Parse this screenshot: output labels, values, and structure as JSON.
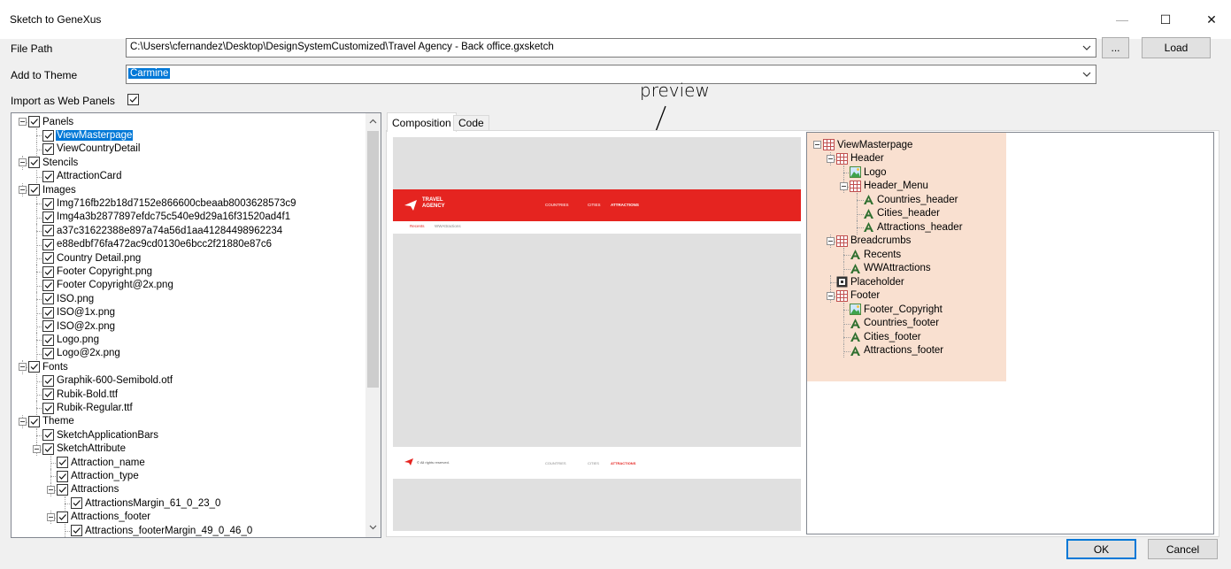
{
  "window": {
    "title": "Sketch to GeneXus",
    "minimize_glyph": "—",
    "maximize_glyph": "☐",
    "close_glyph": "✕"
  },
  "form": {
    "file_path_label": "File Path",
    "file_path_value": "C:\\Users\\cfernandez\\Desktop\\DesignSystemCustomized\\Travel Agency - Back office.gxsketch",
    "browse_label": "...",
    "load_label": "Load",
    "theme_label": "Add to Theme",
    "theme_value": "Carmine",
    "import_label": "Import as Web Panels",
    "import_checked": true
  },
  "annotation": {
    "text": "preview"
  },
  "tabs": [
    {
      "label": "Composition",
      "active": true
    },
    {
      "label": "Code",
      "active": false
    }
  ],
  "tree": [
    {
      "label": "Panels",
      "level": 0,
      "expander": true,
      "checked": true
    },
    {
      "label": "ViewMasterpage",
      "level": 1,
      "checked": true,
      "selected": true
    },
    {
      "label": "ViewCountryDetail",
      "level": 1,
      "checked": true
    },
    {
      "label": "Stencils",
      "level": 0,
      "expander": true,
      "checked": true
    },
    {
      "label": "AttractionCard",
      "level": 1,
      "checked": true
    },
    {
      "label": "Images",
      "level": 0,
      "expander": true,
      "checked": true
    },
    {
      "label": "Img716fb22b18d7152e866600cbeaab8003628573c9",
      "level": 1,
      "checked": true
    },
    {
      "label": "Img4a3b2877897efdc75c540e9d29a16f31520ad4f1",
      "level": 1,
      "checked": true
    },
    {
      "label": "a37c31622388e897a74a56d1aa41284498962234",
      "level": 1,
      "checked": true
    },
    {
      "label": "e88edbf76fa472ac9cd0130e6bcc2f21880e87c6",
      "level": 1,
      "checked": true
    },
    {
      "label": "Country Detail.png",
      "level": 1,
      "checked": true
    },
    {
      "label": "Footer Copyright.png",
      "level": 1,
      "checked": true
    },
    {
      "label": "Footer Copyright@2x.png",
      "level": 1,
      "checked": true
    },
    {
      "label": "ISO.png",
      "level": 1,
      "checked": true
    },
    {
      "label": "ISO@1x.png",
      "level": 1,
      "checked": true
    },
    {
      "label": "ISO@2x.png",
      "level": 1,
      "checked": true
    },
    {
      "label": "Logo.png",
      "level": 1,
      "checked": true
    },
    {
      "label": "Logo@2x.png",
      "level": 1,
      "checked": true
    },
    {
      "label": "Fonts",
      "level": 0,
      "expander": true,
      "checked": true
    },
    {
      "label": "Graphik-600-Semibold.otf",
      "level": 1,
      "checked": true
    },
    {
      "label": "Rubik-Bold.ttf",
      "level": 1,
      "checked": true
    },
    {
      "label": "Rubik-Regular.ttf",
      "level": 1,
      "checked": true
    },
    {
      "label": "Theme",
      "level": 0,
      "expander": true,
      "checked": true
    },
    {
      "label": "SketchApplicationBars",
      "level": 1,
      "checked": true
    },
    {
      "label": "SketchAttribute",
      "level": 1,
      "expander": true,
      "checked": true
    },
    {
      "label": "Attraction_name",
      "level": 2,
      "checked": true
    },
    {
      "label": "Attraction_type",
      "level": 2,
      "checked": true
    },
    {
      "label": "Attractions",
      "level": 2,
      "expander": true,
      "checked": true
    },
    {
      "label": "AttractionsMargin_61_0_23_0",
      "level": 3,
      "checked": true
    },
    {
      "label": "Attractions_footer",
      "level": 2,
      "expander": true,
      "checked": true
    },
    {
      "label": "Attractions_footerMargin_49_0_46_0",
      "level": 3,
      "checked": true
    }
  ],
  "preview": {
    "logo_text_1": "TRAVEL",
    "logo_text_2": "AGENCY",
    "nav": [
      "COUNTRIES",
      "CITIES",
      "ATTRACTIONS"
    ],
    "breadcrumbs": [
      "Recents",
      "WWAttractions"
    ],
    "footer_text": "© All rights reserved.",
    "footer_nav": [
      "COUNTRIES",
      "CITIES",
      "ATTRACTIONS"
    ],
    "brand_color": "#e52420"
  },
  "structure": [
    {
      "label": "ViewMasterpage",
      "level": 0,
      "icon": "table-icon",
      "expander": true
    },
    {
      "label": "Header",
      "level": 1,
      "icon": "table-icon",
      "expander": true
    },
    {
      "label": "Logo",
      "level": 2,
      "icon": "image-icon"
    },
    {
      "label": "Header_Menu",
      "level": 2,
      "icon": "table-icon",
      "expander": true
    },
    {
      "label": "Countries_header",
      "level": 3,
      "icon": "textblock-icon"
    },
    {
      "label": "Cities_header",
      "level": 3,
      "icon": "textblock-icon"
    },
    {
      "label": "Attractions_header",
      "level": 3,
      "icon": "textblock-icon"
    },
    {
      "label": "Breadcrumbs",
      "level": 1,
      "icon": "table-icon",
      "expander": true
    },
    {
      "label": "Recents",
      "level": 2,
      "icon": "textblock-icon"
    },
    {
      "label": "WWAttractions",
      "level": 2,
      "icon": "textblock-icon"
    },
    {
      "label": "Placeholder",
      "level": 1,
      "icon": "placeholder-icon"
    },
    {
      "label": "Footer",
      "level": 1,
      "icon": "table-icon",
      "expander": true
    },
    {
      "label": "Footer_Copyright",
      "level": 2,
      "icon": "image-icon"
    },
    {
      "label": "Countries_footer",
      "level": 2,
      "icon": "textblock-icon"
    },
    {
      "label": "Cities_footer",
      "level": 2,
      "icon": "textblock-icon"
    },
    {
      "label": "Attractions_footer",
      "level": 2,
      "icon": "textblock-icon"
    }
  ],
  "buttons": {
    "ok": "OK",
    "cancel": "Cancel"
  },
  "colors": {
    "selection": "#0078d7",
    "highlight": "#f9e0d0"
  }
}
